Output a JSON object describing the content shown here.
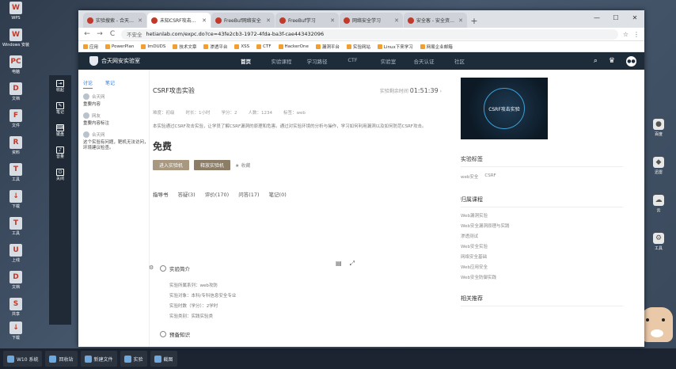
{
  "desktop": {
    "left_icons": [
      {
        "label": "WPS",
        "glyph": "W"
      },
      {
        "label": "Windows 安装",
        "glyph": "W"
      },
      {
        "label": "电脑",
        "glyph": "PC"
      },
      {
        "label": "文档",
        "glyph": "D"
      },
      {
        "label": "文件",
        "glyph": "F"
      },
      {
        "label": "资料",
        "glyph": "R"
      },
      {
        "label": "工具",
        "glyph": "T"
      },
      {
        "label": "下载",
        "glyph": "↓"
      },
      {
        "label": "工具",
        "glyph": "T"
      },
      {
        "label": "上线",
        "glyph": "U"
      },
      {
        "label": "文档",
        "glyph": "D"
      },
      {
        "label": "共享",
        "glyph": "S"
      },
      {
        "label": "下载",
        "glyph": "↓"
      }
    ],
    "right_icons": [
      {
        "label": "百度",
        "glyph": "●"
      },
      {
        "label": "迅雷",
        "glyph": "◆"
      },
      {
        "label": "云",
        "glyph": "☁"
      },
      {
        "label": "工具",
        "glyph": "⚙"
      }
    ]
  },
  "taskbar": {
    "items": [
      "W10 系统",
      "回收站",
      "新建文件",
      "实验",
      "截图"
    ]
  },
  "browser": {
    "tabs": [
      {
        "label": "实验搜索 - 合天网安实验室",
        "active": false
      },
      {
        "label": "未知CSRF攻击实验",
        "active": true
      },
      {
        "label": "FreeBuf网络安全",
        "active": false
      },
      {
        "label": "FreeBuf学习",
        "active": false
      },
      {
        "label": "网络安全学习",
        "active": false
      },
      {
        "label": "安全客 - 安全资讯平台",
        "active": false
      }
    ],
    "window_controls": {
      "min": "—",
      "max": "☐",
      "close": "✕"
    },
    "nav": {
      "back": "←",
      "forward": "→",
      "reload": "C"
    },
    "omnibox": {
      "security": "不安全",
      "url": "hetianlab.com/expc.do?ce=43fe2cb3-1972-4fda-ba3f-cae443432096"
    },
    "omni_right": {
      "star": "☆",
      "menu": "⋮"
    },
    "bookmarks": [
      "应用",
      "PowerPlan",
      "ImDUDS",
      "技术文章",
      "渗透平台",
      "XSS",
      "CTF",
      "HackerOne",
      "漏洞平台",
      "实验网站",
      "Linux下来学习",
      "网易企业邮箱"
    ]
  },
  "site": {
    "logo_text": "合天网安实验室",
    "menu": [
      {
        "label": "首页",
        "active": true
      },
      {
        "label": "实验课程",
        "active": false
      },
      {
        "label": "学习路径",
        "active": false
      },
      {
        "label": "CTF",
        "active": false
      },
      {
        "label": "实验室",
        "active": false
      },
      {
        "label": "合天认证",
        "active": false
      },
      {
        "label": "社区",
        "active": false
      }
    ],
    "search_icon": "⌕",
    "crown_icon": "♛",
    "avatar_text": "●●"
  },
  "float_panel": [
    {
      "icon": "⇥",
      "label": "收起"
    },
    {
      "icon": "✎",
      "label": "笔记"
    },
    {
      "icon": "⌨",
      "label": "键盘"
    },
    {
      "icon": "♪",
      "label": "音量"
    },
    {
      "icon": "⏻",
      "label": "关闭"
    }
  ],
  "left_col": {
    "tabs": [
      {
        "label": "讨论",
        "on": true
      },
      {
        "label": "笔记",
        "on": false
      }
    ],
    "comments": [
      {
        "user": "合天网",
        "text": "重要内容"
      },
      {
        "user": "网友",
        "text": "重要内容标注"
      },
      {
        "user": "合天网",
        "text": "这个实验有问题，靶机无法访问，环境建议检查。"
      }
    ]
  },
  "main": {
    "title": "CSRF攻击实验",
    "timer_label": "实验剩余时间",
    "timer_value": "01:51:39",
    "meta": [
      "难度：初级",
      "时长：1小时",
      "学分：2",
      "人数：1234",
      "标签：web"
    ],
    "description": "本实验通过CSRF攻击实验，让学员了解CSRF漏洞的原理和危害。通过对实验环境的分析与操作，学习如何利用漏洞以及如何防范CSRF攻击。",
    "price": "免费",
    "btn_start": "进入实验机",
    "btn_reset": "释放实验机",
    "fav_label": "★ 收藏",
    "content_tabs": [
      {
        "label": "指导书",
        "on": true
      },
      {
        "label": "答疑(3)",
        "on": false
      },
      {
        "label": "评价(170)",
        "on": false
      },
      {
        "label": "问答(17)",
        "on": false
      },
      {
        "label": "笔记(0)",
        "on": false
      }
    ],
    "tools": {
      "book": "▤",
      "expand": "⤢"
    },
    "section_title": "实验简介",
    "section_lines": [
      "实验所属系列：web攻防",
      "实验对象：本科/专科信息安全专业",
      "实验时数（学分）：2学时",
      "实验类别：实践实验类"
    ],
    "section2_title": "预备知识"
  },
  "right_col": {
    "banner_text": "CSRF攻击实验",
    "tag_title": "实验标签",
    "tags": [
      "web安全",
      "CSRF"
    ],
    "course_title": "归属课程",
    "courses": [
      "Web漏洞实验",
      "Web安全漏洞原理与实践",
      "渗透测试",
      "Web安全实验",
      "网络安全基础",
      "Web应用安全",
      "Web安全防御实践"
    ],
    "related_title": "相关推荐"
  }
}
